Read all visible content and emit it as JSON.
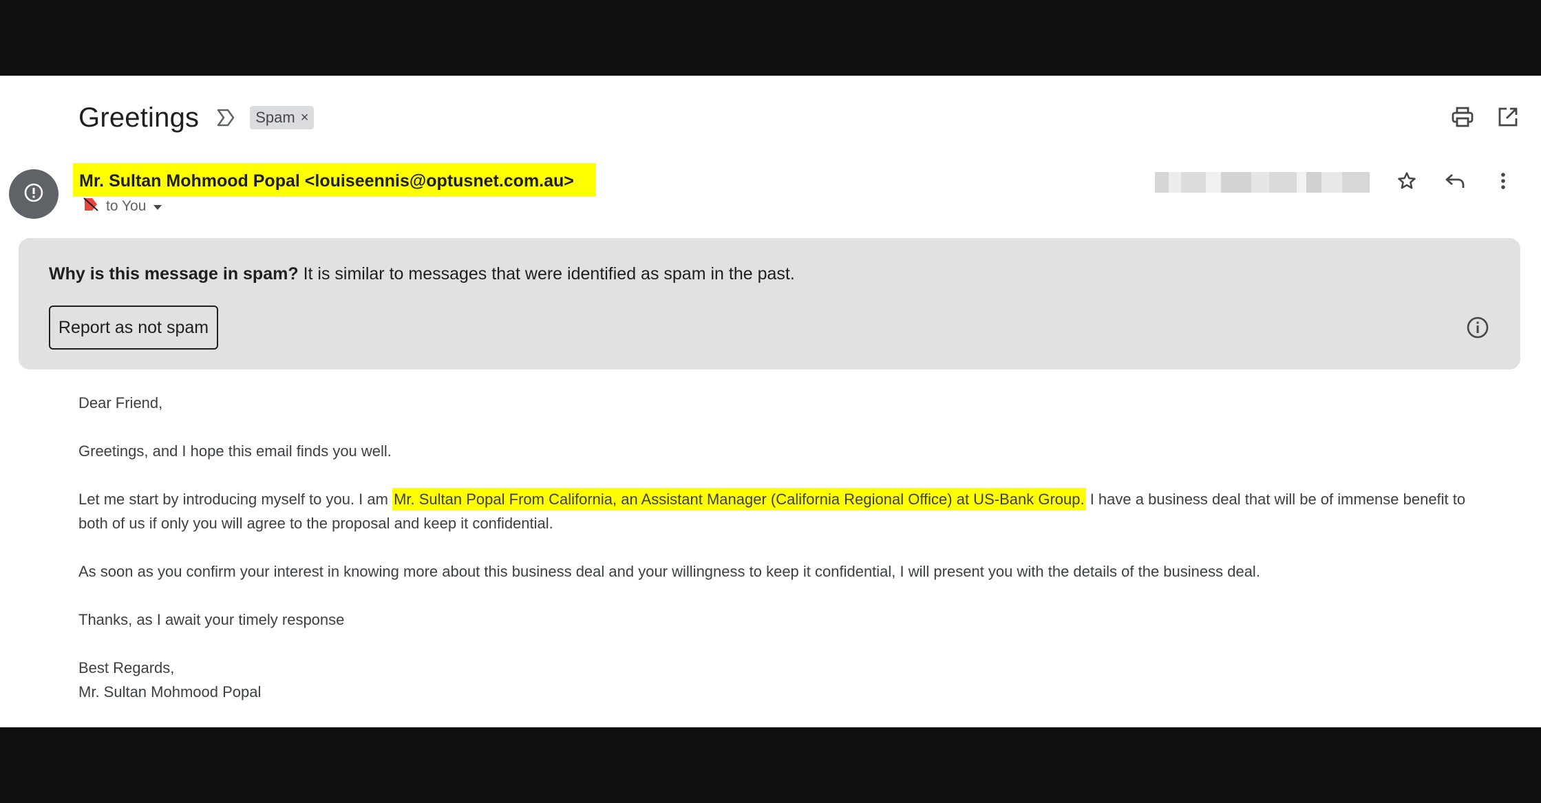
{
  "subject": "Greetings",
  "labels": {
    "spam_chip": "Spam",
    "remove_symbol": "×"
  },
  "sender": {
    "display": "Mr. Sultan Mohmood Popal <louiseennis@optusnet.com.au>"
  },
  "recipient": {
    "label": "to You"
  },
  "spam_banner": {
    "question": "Why is this message in spam?",
    "explanation": " It is similar to messages that were identified as spam in the past.",
    "button_label": "Report as not spam"
  },
  "body": {
    "greeting": "Dear Friend,",
    "line1": "Greetings, and I hope this email finds you well.",
    "line2_pre": "Let me start by introducing myself to you. I am ",
    "line2_highlight": "Mr. Sultan Popal From California, an Assistant Manager (California Regional Office) at US-Bank Group.",
    "line2_post": " I have a business deal that will be of immense benefit to both of us if only you will agree to the proposal and keep it confidential.",
    "line3": "As soon as you confirm your interest in knowing more about this business deal and your willingness to keep it confidential, I will present you with the details of the business deal.",
    "line4": "Thanks, as I await your timely response",
    "signoff": "Best Regards,",
    "signature": "Mr. Sultan Mohmood Popal"
  },
  "icons": {
    "print": "print-icon",
    "open_new_window": "open-in-new-window-icon",
    "star": "star-icon",
    "reply": "reply-icon",
    "more": "more-vert-icon",
    "important_marker": "importance-marker-icon",
    "warning": "warning-icon",
    "info": "info-icon"
  },
  "colors": {
    "highlight": "#ffff00",
    "banner_bg": "#e1e1e1",
    "avatar_bg": "#5f6368",
    "frame": "#0f0f0f"
  }
}
